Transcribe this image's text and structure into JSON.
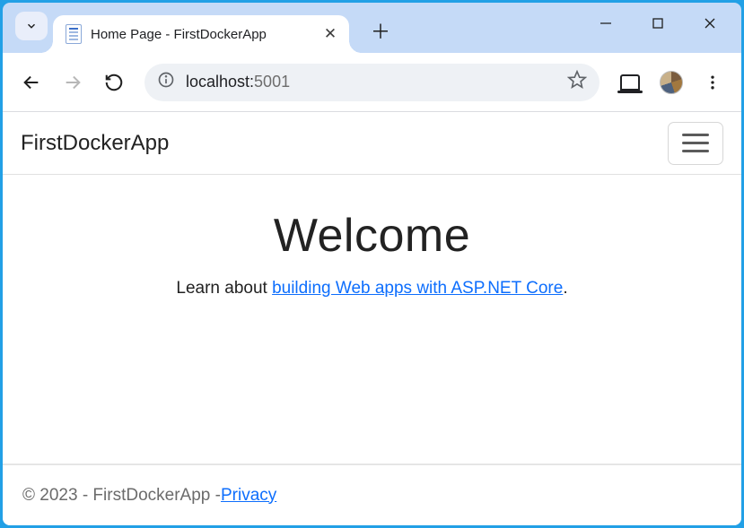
{
  "window": {
    "tab_title": "Home Page - FirstDockerApp"
  },
  "toolbar": {
    "url_host": "localhost:",
    "url_port": "5001"
  },
  "navbar": {
    "brand": "FirstDockerApp"
  },
  "hero": {
    "title": "Welcome",
    "lead_prefix": "Learn about ",
    "lead_link": "building Web apps with ASP.NET Core",
    "lead_suffix": "."
  },
  "footer": {
    "text": "© 2023 - FirstDockerApp - ",
    "link": "Privacy"
  }
}
